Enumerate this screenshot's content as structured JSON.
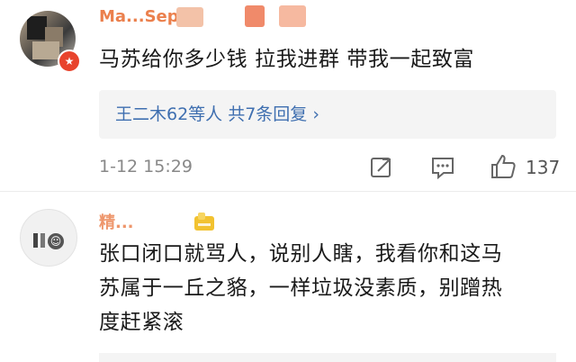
{
  "comments": [
    {
      "username": "Ma...Sepp",
      "text": "马苏给你多少钱 拉我进群 带我一起致富",
      "replies_summary": "王二木62等人  共7条回复 ›",
      "timestamp": "1-12 15:29",
      "likes": "137",
      "verified_badge": "★"
    },
    {
      "username": "精...",
      "text_lines": [
        "张口闭口就骂人，说别人瞎，我看你和这马",
        "苏属于一丘之貉，一样垃圾没素质，别蹭热",
        "度赶紧滚"
      ]
    }
  ],
  "colors": {
    "username": "#e86b2e",
    "reply_link": "#3f6fb0",
    "meta": "#888888",
    "badge": "#e8432c"
  },
  "icons": [
    "share-icon",
    "comment-icon",
    "like-icon",
    "emoji-sticker-icon"
  ]
}
